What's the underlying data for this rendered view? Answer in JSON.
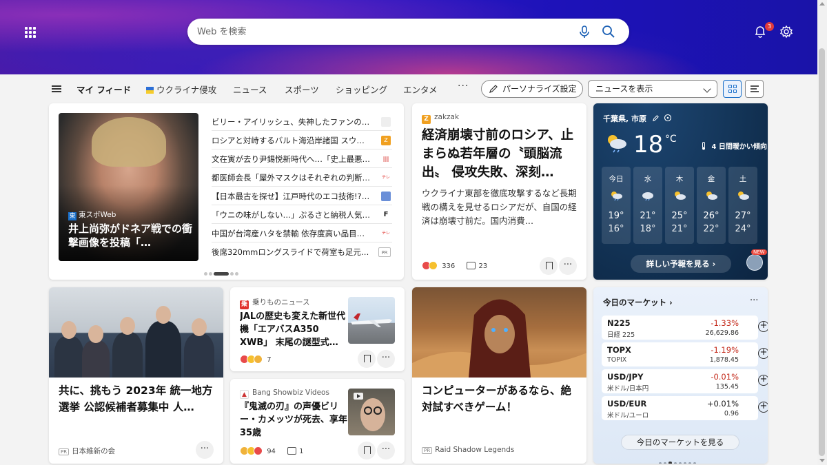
{
  "header": {
    "search_placeholder": "Web を検索",
    "notification_count": "3"
  },
  "nav": {
    "items": [
      {
        "label": "マイ フィード",
        "active": true
      },
      {
        "label": "ウクライナ侵攻",
        "active": false
      },
      {
        "label": "ニュース",
        "active": false
      },
      {
        "label": "スポーツ",
        "active": false
      },
      {
        "label": "ショッピング",
        "active": false
      },
      {
        "label": "エンタメ",
        "active": false
      }
    ],
    "more": "···",
    "personalize": "パーソナライズ設定",
    "news_dropdown": "ニュースを表示"
  },
  "carousel": {
    "source": "東スポWeb",
    "source_logo": "東",
    "title": "井上尚弥がドネア戦での衝撃画像を投稿「…",
    "headlines": [
      {
        "text": "ビリー・アイリッシュ、失神したファンの…",
        "icon_color": "#e8e8e8",
        "icon_text": ""
      },
      {
        "text": "ロシアと対峙するバルト海沿岸諸国 スウ…",
        "icon_color": "#f0a020",
        "icon_text": "Z"
      },
      {
        "text": "文在寅が去り尹錫悦新時代へ…「史上最悪…",
        "icon_color": "#d8302a",
        "icon_text": "|||"
      },
      {
        "text": "都医師会長「屋外マスクはそれぞれの判断…",
        "icon_color": "#e0302a",
        "icon_text": "テレ"
      },
      {
        "text": "【日本最古を探せ】江戸時代のエコ技術!?…",
        "icon_color": "#6a8fd8",
        "icon_text": ""
      },
      {
        "text": "「ウニの味がしない…」ぷるさと納税人気の…",
        "icon_color": "#222222",
        "icon_text": "F"
      },
      {
        "text": "中国が台湾産ハタを禁輸 依存度高い品目…",
        "icon_color": "#e0302a",
        "icon_text": "テレ"
      },
      {
        "text": "後席320mmロングスライドで荷室も足元…",
        "icon_color": "#ffffff",
        "icon_text": "PR"
      }
    ]
  },
  "zakzak": {
    "source": "zakzak",
    "title": "経済崩壊寸前のロシア、止まらぬ若年層の〝頭脳流出〟 侵攻失敗、深刻…",
    "body": "ウクライナ東部を徹底攻撃するなど長期戦の構えを見せるロシアだが、自国の経済は崩壊寸前だ。国内消費…",
    "reactions": "336",
    "comments": "23"
  },
  "weather": {
    "location": "千葉県, 市原",
    "temperature": "18",
    "unit": "°C",
    "summary": "4 日間暖かい傾向",
    "forecast": [
      {
        "day": "今日",
        "hi": "19°",
        "lo": "16°"
      },
      {
        "day": "水",
        "hi": "21°",
        "lo": "18°"
      },
      {
        "day": "木",
        "hi": "25°",
        "lo": "21°"
      },
      {
        "day": "金",
        "hi": "26°",
        "lo": "22°"
      },
      {
        "day": "土",
        "hi": "27°",
        "lo": "24°"
      }
    ],
    "detail_button": "詳しい予報を見る ›",
    "new_badge": "NEW"
  },
  "ishin": {
    "title": "共に、挑もう 2023年 統一地方選挙 公認候補者募集中 人…",
    "pr": "PR",
    "sponsor": "日本維新の会"
  },
  "norimono": {
    "source": "乗りものニュース",
    "source_logo": "乗",
    "title": "JALの歴史も変えた新世代機「エアバスA350 XWB」 末尾の謎型式…",
    "reactions": "7"
  },
  "showbiz": {
    "source": "Bang Showbiz Videos",
    "title": "『鬼滅の刃』の声優ビリー・カメッツが死去、享年35歳",
    "reactions": "94",
    "comments": "1"
  },
  "raid": {
    "title": "コンピューターがあるなら、絶対試すべきゲーム！",
    "pr": "PR",
    "sponsor": "Raid Shadow Legends"
  },
  "market": {
    "title": "今日のマーケット ›",
    "rows": [
      {
        "name": "N225",
        "sub": "日経 225",
        "change": "-1.33%",
        "value": "26,629.86",
        "color": "#c42b1c"
      },
      {
        "name": "TOPX",
        "sub": "TOPIX",
        "change": "-1.19%",
        "value": "1,878.45",
        "color": "#c42b1c"
      },
      {
        "name": "USD/JPY",
        "sub": "米ドル/日本円",
        "change": "-0.01%",
        "value": "135.45",
        "color": "#c42b1c"
      },
      {
        "name": "USD/EUR",
        "sub": "米ドル/ユーロ",
        "change": "+0.01%",
        "value": "0.96",
        "color": "#1b1b1b"
      }
    ],
    "button": "今日のマーケットを見る"
  }
}
